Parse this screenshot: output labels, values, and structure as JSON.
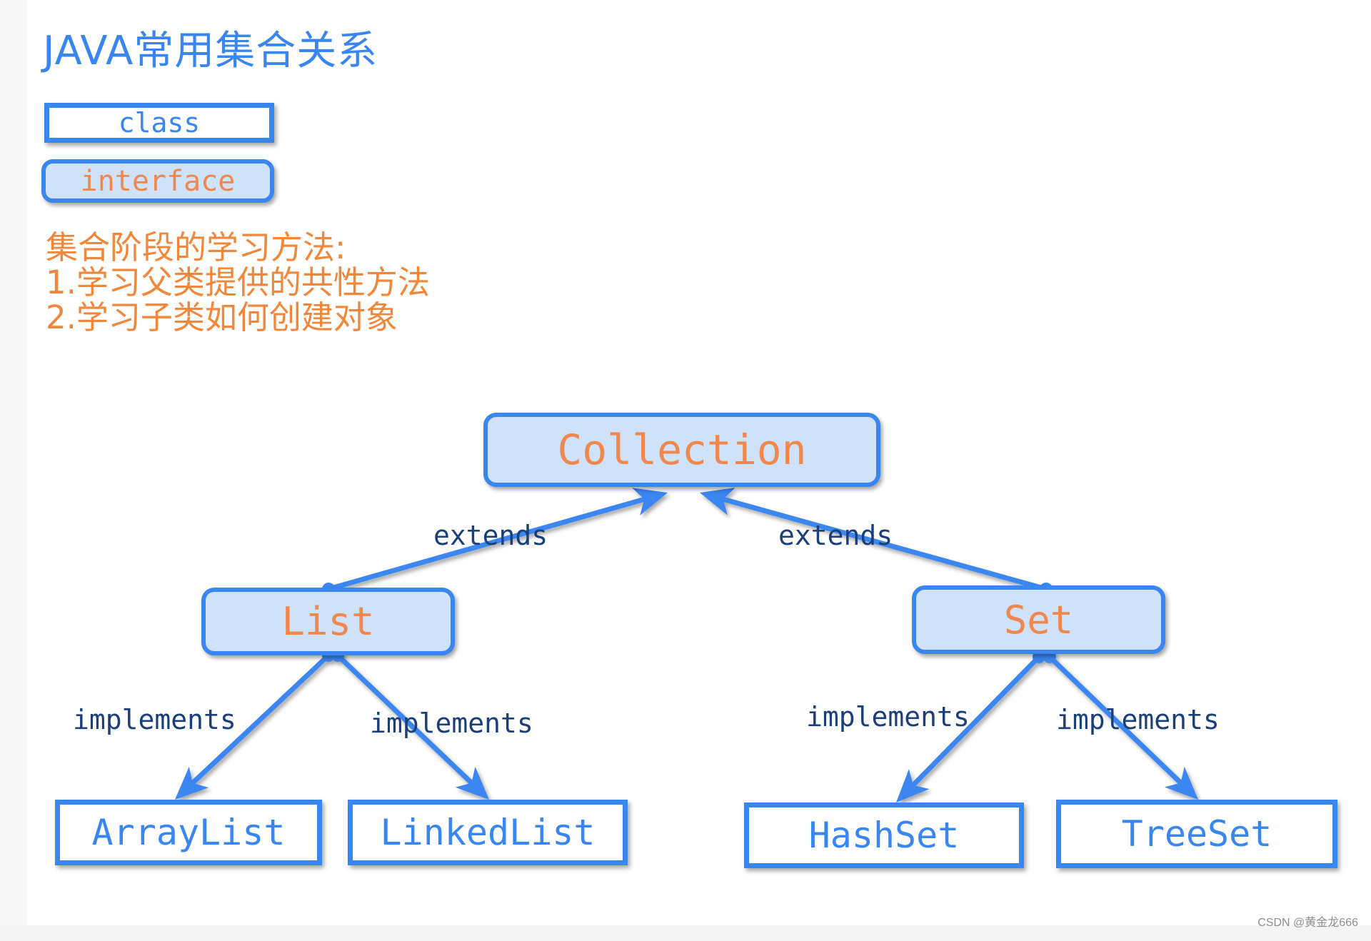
{
  "title": "JAVA常用集合关系",
  "legend": {
    "class_label": "class",
    "interface_label": "interface"
  },
  "notes": {
    "heading": "集合阶段的学习方法:",
    "line1": "1.学习父类提供的共性方法",
    "line2": "2.学习子类如何创建对象"
  },
  "nodes": {
    "collection": {
      "label": "Collection",
      "kind": "interface"
    },
    "list": {
      "label": "List",
      "kind": "interface"
    },
    "set": {
      "label": "Set",
      "kind": "interface"
    },
    "arraylist": {
      "label": "ArrayList",
      "kind": "class"
    },
    "linkedlist": {
      "label": "LinkedList",
      "kind": "class"
    },
    "hashset": {
      "label": "HashSet",
      "kind": "class"
    },
    "treeset": {
      "label": "TreeSet",
      "kind": "class"
    }
  },
  "edges": [
    {
      "from": "list",
      "to": "collection",
      "label": "extends"
    },
    {
      "from": "set",
      "to": "collection",
      "label": "extends"
    },
    {
      "from": "list",
      "to": "arraylist",
      "label": "implements"
    },
    {
      "from": "list",
      "to": "linkedlist",
      "label": "implements"
    },
    {
      "from": "set",
      "to": "hashset",
      "label": "implements"
    },
    {
      "from": "set",
      "to": "treeset",
      "label": "implements"
    }
  ],
  "colors": {
    "accent_blue": "#3a86f0",
    "interface_fill": "#cfe2fa",
    "interface_text": "#f0874c",
    "notes_text": "#f0873a",
    "edge_label_text": "#1b3f78"
  },
  "watermark": "CSDN @黄金龙666"
}
